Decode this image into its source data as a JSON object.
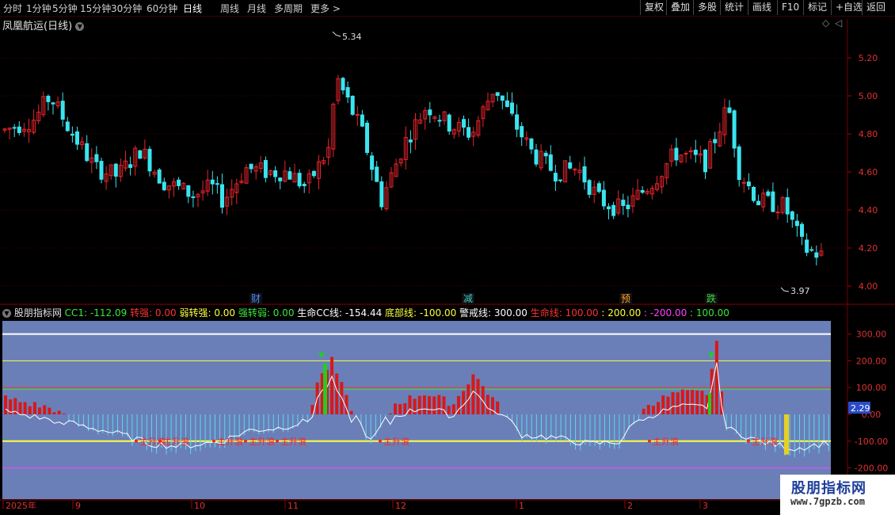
{
  "timeframes": [
    "分时",
    "1分钟",
    "5分钟",
    "15分钟",
    "30分钟",
    "60分钟",
    "日线",
    "周线",
    "月线",
    "多周期",
    "更多 >"
  ],
  "active_timeframe": "日线",
  "toolbar": [
    "复权",
    "叠加",
    "多股",
    "统计",
    "画线",
    "F10",
    "标记",
    "+自选",
    "返回"
  ],
  "stock_title": "凤凰航运(日线)",
  "price_axis": [
    "5.20",
    "5.00",
    "4.80",
    "4.60",
    "4.40",
    "4.20",
    "4.00"
  ],
  "high_label": "5.34",
  "low_label": "3.97",
  "event_markers": [
    {
      "text": "财",
      "color": "#4d8cff"
    },
    {
      "text": "减",
      "color": "#3cc8c8"
    },
    {
      "text": "预",
      "color": "#ff9c2a"
    },
    {
      "text": "跌",
      "color": "#3cd83c"
    }
  ],
  "indicator": {
    "name": "股朋指标网",
    "items": [
      {
        "text": "CC1: -112.09",
        "color": "#3ce63c"
      },
      {
        "text": "转强: 0.00",
        "color": "#ff3030"
      },
      {
        "text": "弱转强: 0.00",
        "color": "#ffff40"
      },
      {
        "text": "强转弱: 0.00",
        "color": "#3ce63c"
      },
      {
        "text": "生命CC线: -154.44",
        "color": "#ffffff"
      },
      {
        "text": "底部线: -100.00",
        "color": "#ffff40"
      },
      {
        "text": "警戒线: 300.00",
        "color": "#ffffff"
      },
      {
        "text": "生命线: 100.00",
        "color": "#ff3030"
      },
      {
        "text": ": 200.00",
        "color": "#ffff40"
      },
      {
        "text": ": -200.00",
        "color": "#ff40ff"
      },
      {
        "text": ": 100.00",
        "color": "#3ce63c"
      }
    ]
  },
  "indicator_axis": [
    "300.00",
    "200.00",
    "100.00",
    "0.00",
    "-100.00",
    "-200.00"
  ],
  "current_value": "2.29",
  "wave_labels": [
    "主升浪",
    "主升浪",
    "主升浪",
    "主升浪",
    "主升浪",
    "主升浪",
    "主升浪",
    "主升浪"
  ],
  "date_axis": [
    "2025年",
    "9",
    "10",
    "11",
    "12",
    "1",
    "2",
    "3"
  ],
  "watermark": {
    "line1": "股朋指标网",
    "line2": "www.7gpzb.com"
  },
  "colors": {
    "up": "#e8242c",
    "down": "#3ae4ee",
    "bg": "#000000",
    "panel": "#6a7fb8"
  }
}
